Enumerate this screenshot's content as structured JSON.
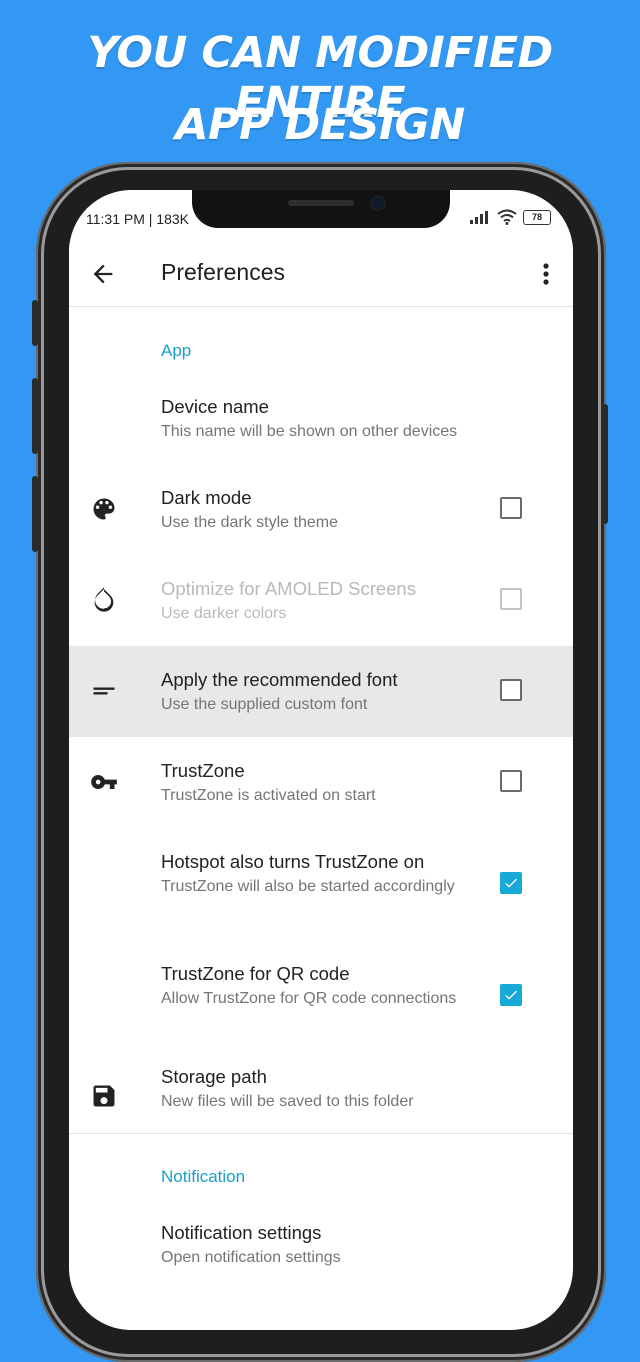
{
  "promo": {
    "line1": "YOU CAN MODIFIED ENTIRE",
    "line2": "APP DESIGN"
  },
  "status_bar": {
    "time": "11:31 PM | 183K",
    "battery": "78"
  },
  "app_bar": {
    "title": "Preferences",
    "back_icon": "arrow-left-icon",
    "menu_icon": "more-vertical-icon"
  },
  "sections": [
    {
      "header": "App",
      "items": [
        {
          "title": "Device name",
          "subtitle": "This name will be shown on other devices"
        },
        {
          "title": "Dark mode",
          "subtitle": "Use the dark style theme",
          "icon": "palette-icon",
          "checked": false
        },
        {
          "title": "Optimize for AMOLED Screens",
          "subtitle": "Use darker colors",
          "icon": "contrast-drop-icon",
          "checked": false,
          "disabled": true
        },
        {
          "title": "Apply the recommended font",
          "subtitle": "Use the supplied custom font",
          "icon": "short-text-icon",
          "checked": false
        },
        {
          "title": "TrustZone",
          "subtitle": "TrustZone is activated on start",
          "icon": "key-icon",
          "checked": false
        },
        {
          "title": "Hotspot also turns TrustZone on",
          "subtitle": "TrustZone will also be started accordingly",
          "checked": true
        },
        {
          "title": "TrustZone for QR code",
          "subtitle": "Allow TrustZone for QR code connections",
          "checked": true
        },
        {
          "title": "Storage path",
          "subtitle": "New files will be saved to this folder",
          "icon": "save-icon"
        }
      ]
    },
    {
      "header": "Notification",
      "items": [
        {
          "title": "Notification settings",
          "subtitle": "Open notification settings"
        }
      ]
    }
  ],
  "colors": {
    "background": "#3398f3",
    "accent": "#1a9fc7",
    "checkbox_checked": "#19a9d9"
  }
}
